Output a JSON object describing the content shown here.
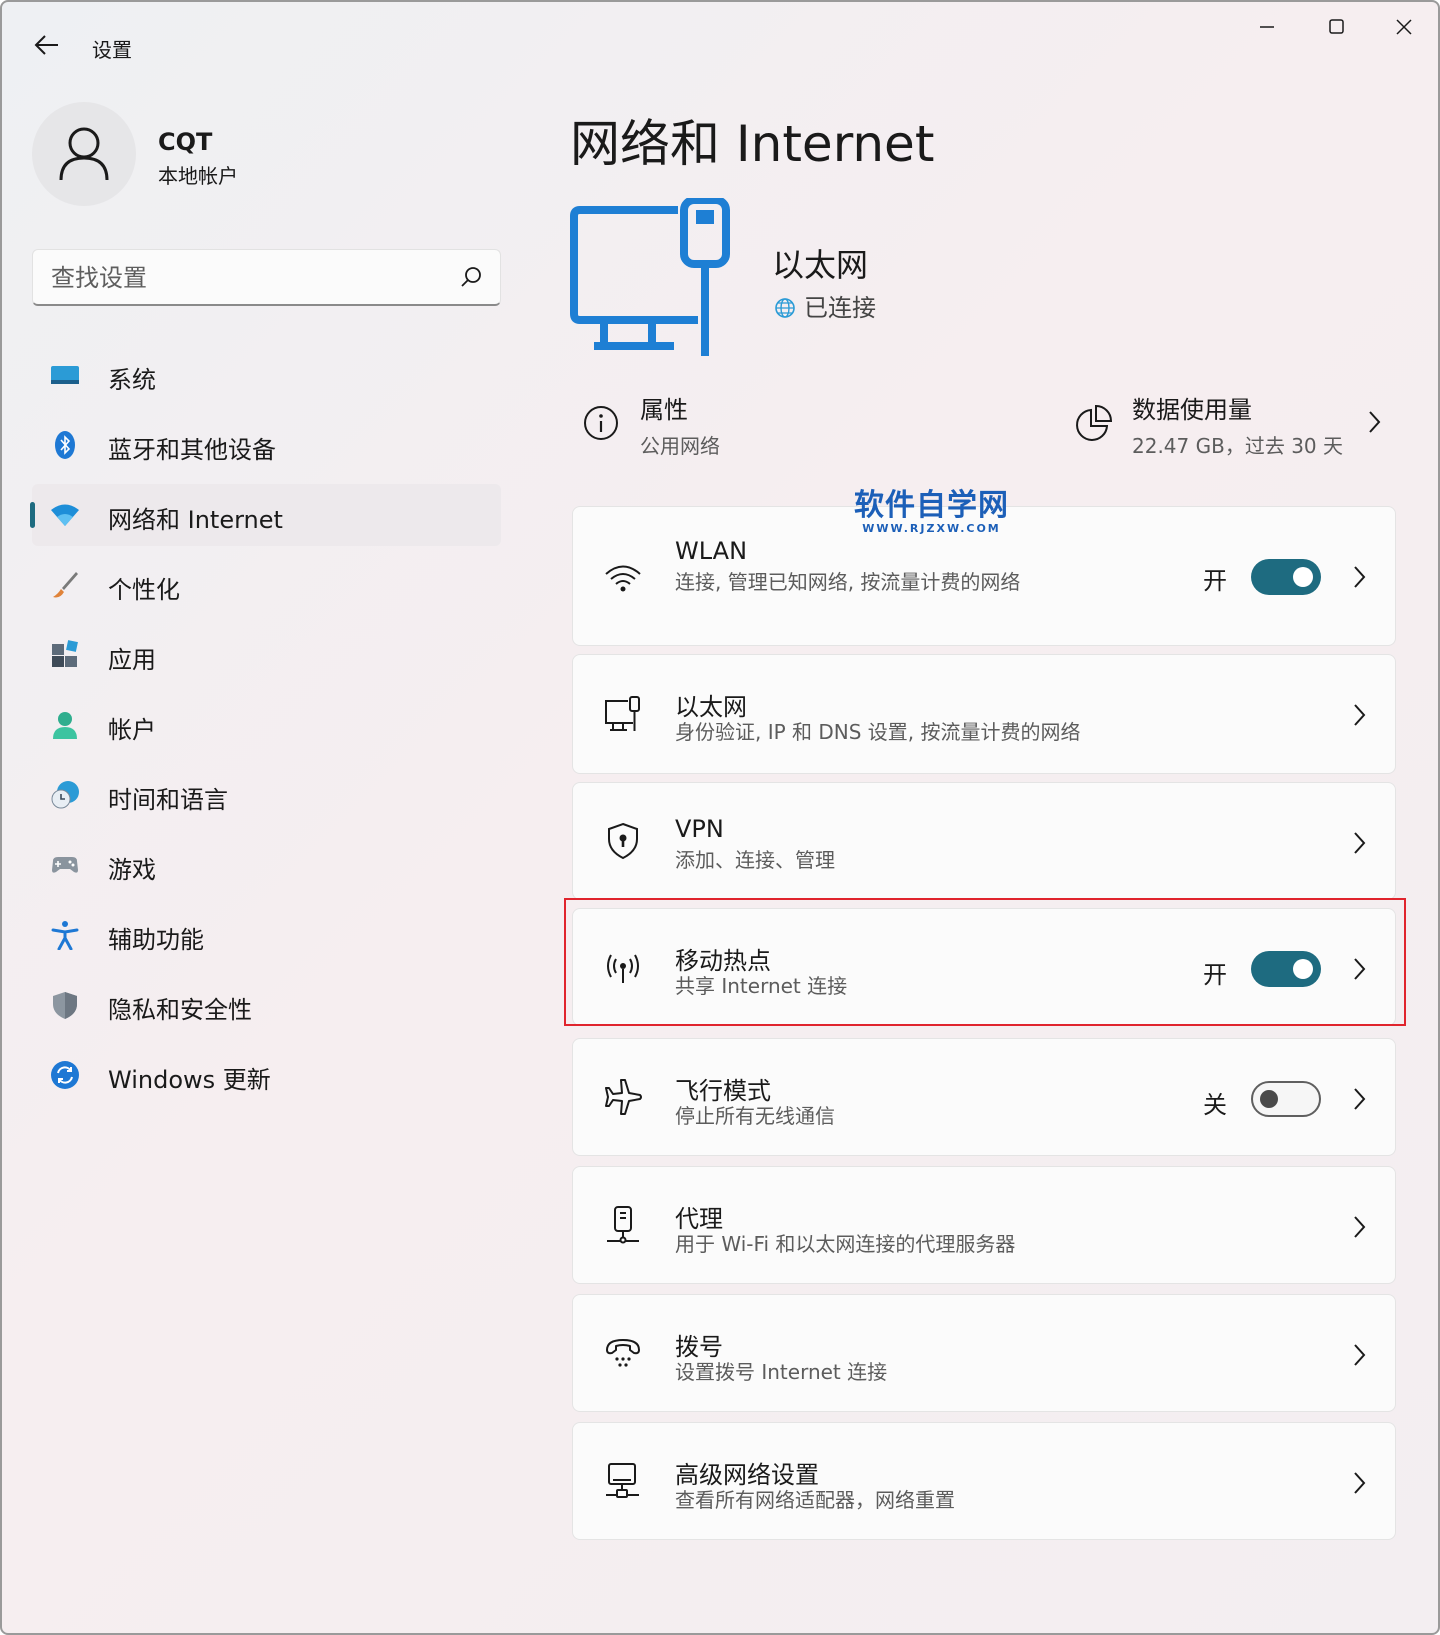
{
  "window": {
    "title": "设置"
  },
  "user": {
    "name": "CQT",
    "account_type": "本地帐户"
  },
  "search": {
    "placeholder": "查找设置"
  },
  "sidebar": {
    "items": [
      {
        "label": "系统",
        "icon": "system-icon"
      },
      {
        "label": "蓝牙和其他设备",
        "icon": "bluetooth-icon"
      },
      {
        "label": "网络和 Internet",
        "icon": "network-icon",
        "selected": true
      },
      {
        "label": "个性化",
        "icon": "brush-icon"
      },
      {
        "label": "应用",
        "icon": "apps-icon"
      },
      {
        "label": "帐户",
        "icon": "account-icon"
      },
      {
        "label": "时间和语言",
        "icon": "time-language-icon"
      },
      {
        "label": "游戏",
        "icon": "gamepad-icon"
      },
      {
        "label": "辅助功能",
        "icon": "accessibility-icon"
      },
      {
        "label": "隐私和安全性",
        "icon": "shield-icon"
      },
      {
        "label": "Windows 更新",
        "icon": "update-icon"
      }
    ]
  },
  "main": {
    "title": "网络和 Internet",
    "hero": {
      "name": "以太网",
      "status": "已连接"
    },
    "properties": {
      "title": "属性",
      "subtitle": "公用网络"
    },
    "data_usage": {
      "title": "数据使用量",
      "subtitle": "22.47 GB，过去 30 天"
    },
    "watermark": {
      "main": "软件自学网",
      "sub": "WWW.RJZXW.COM"
    },
    "cards": [
      {
        "title": "WLAN",
        "subtitle": "连接, 管理已知网络, 按流量计费的网络",
        "state": "开",
        "toggle": "on",
        "icon": "wifi-icon"
      },
      {
        "title": "以太网",
        "subtitle": "身份验证, IP 和 DNS 设置, 按流量计费的网络",
        "icon": "ethernet-icon"
      },
      {
        "title": "VPN",
        "subtitle": "添加、连接、管理",
        "icon": "vpn-shield-icon"
      },
      {
        "title": "移动热点",
        "subtitle": "共享 Internet 连接",
        "state": "开",
        "toggle": "on",
        "icon": "hotspot-icon"
      },
      {
        "title": "飞行模式",
        "subtitle": "停止所有无线通信",
        "state": "关",
        "toggle": "off",
        "icon": "airplane-icon"
      },
      {
        "title": "代理",
        "subtitle": "用于 Wi-Fi 和以太网连接的代理服务器",
        "icon": "proxy-icon"
      },
      {
        "title": "拨号",
        "subtitle": "设置拨号 Internet 连接",
        "icon": "dialup-icon"
      },
      {
        "title": "高级网络设置",
        "subtitle": "查看所有网络适配器，网络重置",
        "icon": "advanced-network-icon"
      }
    ]
  },
  "colors": {
    "accent": "#1e6b80",
    "highlight": "#e0242d",
    "brand_blue": "#1c5fb8"
  }
}
